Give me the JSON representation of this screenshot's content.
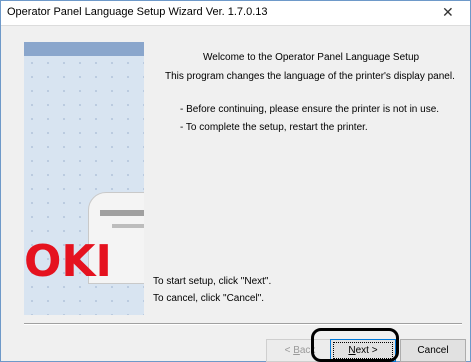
{
  "window": {
    "title": "Operator Panel Language Setup Wizard Ver. 1.7.0.13",
    "close_glyph": "✕"
  },
  "banner": {
    "logo": "OKI"
  },
  "content": {
    "heading": "Welcome to the Operator Panel Language Setup",
    "description": "This program changes the language of the printer's display panel.",
    "notes": [
      "- Before continuing, please ensure the printer is not in use.",
      "- To complete the setup, restart the printer."
    ],
    "start_hint": "To start setup, click \"Next\".",
    "cancel_hint": "To cancel, click \"Cancel\"."
  },
  "buttons": {
    "back": {
      "mnemonic": "B",
      "rest": "ack",
      "prefix": "< "
    },
    "next": {
      "mnemonic": "N",
      "rest": "ext",
      "suffix": " >"
    },
    "cancel": "Cancel"
  },
  "colors": {
    "accent": "#0078d7",
    "logo": "#e5121f",
    "banner": "#d8e4f1"
  }
}
